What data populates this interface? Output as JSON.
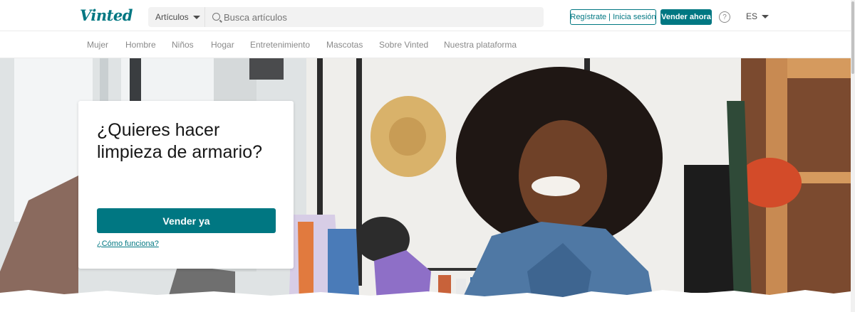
{
  "header": {
    "logo_text": "Vinted",
    "search": {
      "category_label": "Artículos",
      "placeholder": "Busca artículos"
    },
    "signup_label": "Regístrate | Inicia sesión",
    "sell_label": "Vender ahora",
    "help_symbol": "?",
    "language": "ES"
  },
  "nav": {
    "items": [
      "Mujer",
      "Hombre",
      "Niños",
      "Hogar",
      "Entretenimiento",
      "Mascotas",
      "Sobre Vinted",
      "Nuestra plataforma"
    ]
  },
  "hero": {
    "title": "¿Quieres hacer limpieza de armario?",
    "cta_label": "Vender ya",
    "how_link": "¿Cómo funciona?"
  },
  "colors": {
    "brand": "#007782",
    "nav_text": "#8a8a8a"
  },
  "icons": {
    "search": "search-icon",
    "help": "help-icon",
    "dropdown": "chevron-down-icon"
  }
}
